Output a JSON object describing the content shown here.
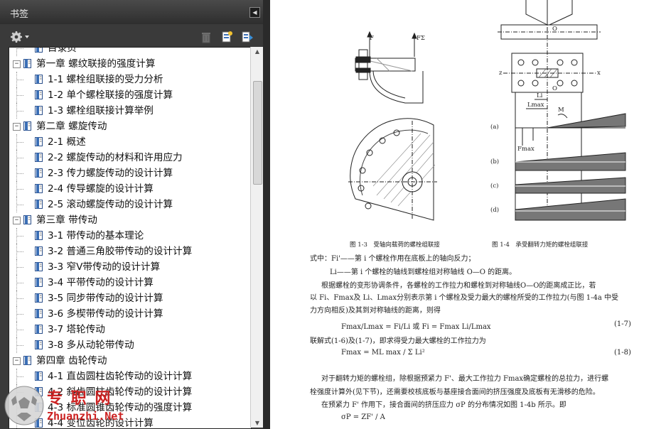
{
  "panel": {
    "title": "书签",
    "toolbar": {
      "options_icon": "gear-icon",
      "delete_icon": "trash-icon",
      "new_bookmark_icon": "new-bookmark-icon",
      "expand_icon": "bookmark-expand-icon"
    }
  },
  "bookmarks": [
    {
      "label": "目录页",
      "level": 1
    },
    {
      "label": "第一章 螺纹联接的强度计算",
      "level": 0
    },
    {
      "label": "1-1 螺栓组联接的受力分析",
      "level": 1
    },
    {
      "label": "1-2 单个螺栓联接的强度计算",
      "level": 1
    },
    {
      "label": "1-3 螺栓组联接计算举例",
      "level": 1
    },
    {
      "label": "第二章 螺旋传动",
      "level": 0
    },
    {
      "label": "2-1 概述",
      "level": 1
    },
    {
      "label": "2-2 螺旋传动的材料和许用应力",
      "level": 1
    },
    {
      "label": "2-3 传力螺旋传动的设计计算",
      "level": 1
    },
    {
      "label": "2-4 传导螺旋的设计计算",
      "level": 1
    },
    {
      "label": "2-5 滚动螺旋传动的设计计算",
      "level": 1
    },
    {
      "label": "第三章 带传动",
      "level": 0
    },
    {
      "label": "3-1 带传动的基本理论",
      "level": 1
    },
    {
      "label": "3-2 普通三角胶带传动的设计计算",
      "level": 1
    },
    {
      "label": "3-3 窄V带传动的设计计算",
      "level": 1
    },
    {
      "label": "3-4 平带传动的设计计算",
      "level": 1
    },
    {
      "label": "3-5 同步带传动的设计计算",
      "level": 1
    },
    {
      "label": "3-6 多楔带传动的设计计算",
      "level": 1
    },
    {
      "label": "3-7 塔轮传动",
      "level": 1
    },
    {
      "label": "3-8 多从动轮带传动",
      "level": 1
    },
    {
      "label": "第四章 齿轮传动",
      "level": 0
    },
    {
      "label": "4-1 直齿圆柱齿轮传动的设计计算",
      "level": 1
    },
    {
      "label": "4-2 斜齿圆柱齿轮传动的设计计算",
      "level": 1
    },
    {
      "label": "4-3 标准圆锥齿轮传动的强度计算",
      "level": 1
    },
    {
      "label": "4-4 变位齿轮的设计计算",
      "level": 1
    }
  ],
  "document": {
    "fig_3_caption": "图 1-3　受轴向载荷的螺栓组联接",
    "fig_4_caption": "图 1-4　承受翻转力矩的螺栓组联接",
    "fig_labels": {
      "a": "(a)",
      "b": "(b)",
      "c": "(c)",
      "d": "(d)",
      "F": "F",
      "FE": "FΣ",
      "M": "M",
      "O": "O",
      "Fmax": "Fmax",
      "Li": "Li",
      "Lmax": "Lmax",
      "x": "x",
      "z": "z"
    },
    "lines": [
      "式中：Fi'——第 i 个螺栓作用在底板上的轴向反力；",
      "Li——第 i 个螺栓的轴线到螺栓组对称轴线 O—O 的距离。",
      "根据螺栓的变形协调条件，各螺栓的工作拉力和螺栓到对称轴线O—O的距离成正比，若",
      "以 Fi、Fmax及 Li、Lmax分别表示第 i 个螺栓及受力最大的螺栓所受的工作拉力(与图 1-4a 中受",
      "力方向相反)及其到对称轴线的距离，则得",
      "Fmax/Lmax = Fi/Li 或 Fi = Fmax Li/Lmax",
      "联解式(1-6)及(1-7)，即求得受力最大螺栓的工作拉力为",
      "Fmax = ML max / Σ Li²",
      "对于翻转力矩的螺栓组，除根据预紧力 F'、最大工作拉力 Fmax确定螺栓的总拉力，进行螺",
      "栓强度计算外(见下节)，还需要校核底板与基座接合面间的挤压强度及底板有无滑移的危险。",
      "在预紧力 F' 作用下，接合面间的挤压应力 σP 的分布情况如图 1-4b 所示。即",
      "σP = ZF' / A"
    ],
    "eq_7": "(1-7)",
    "eq_8": "(1-8)"
  },
  "watermark": {
    "text_cn": "专  职  网",
    "text_en": "Zhuanzhi.Net"
  }
}
